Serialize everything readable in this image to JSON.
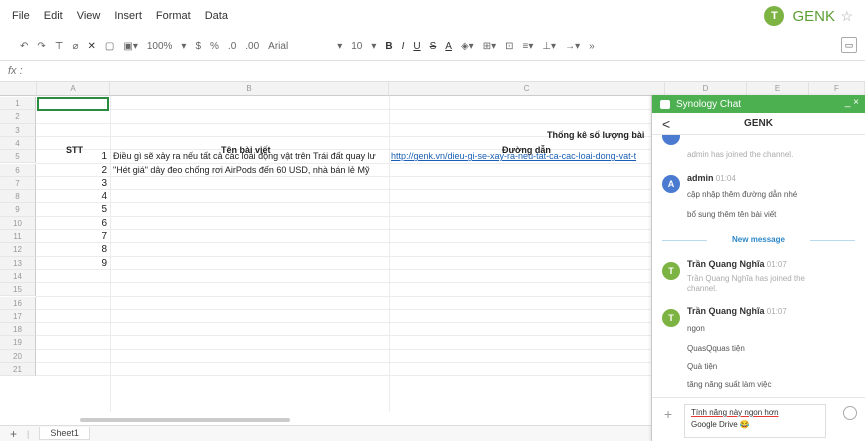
{
  "menu": [
    "File",
    "Edit",
    "View",
    "Insert",
    "Format",
    "Data"
  ],
  "brand": {
    "initial": "T",
    "name": "GENK",
    "star": "☆"
  },
  "toolbar": {
    "zoom": "100%",
    "currency": "$",
    "percent": "%",
    "font": "Arial",
    "font_size": "10",
    "bold": "B",
    "italic": "I",
    "underline": "U",
    "strike": "S",
    "textcolor": "A"
  },
  "formula": {
    "label": "fx :"
  },
  "columns": [
    "A",
    "B",
    "C",
    "D",
    "E",
    "F"
  ],
  "rows": [
    "1",
    "2",
    "3",
    "4",
    "5",
    "6",
    "7",
    "8",
    "9",
    "10",
    "11",
    "12",
    "13",
    "14",
    "15",
    "16",
    "17",
    "18",
    "19",
    "20",
    "21"
  ],
  "sheet": {
    "header_title": "Thống kê số lượng bài",
    "col_stt": "STT",
    "col_title": "Tên bài viết",
    "col_link": "Đường dẫn",
    "data": [
      {
        "stt": "1",
        "title": "Điều gì sẽ xảy ra nếu tất cả các loài động vật trên Trái đất quay lư",
        "link": "http://genk.vn/dieu-gi-se-xay-ra-neu-tat-ca-cac-loai-dong-vat-t"
      },
      {
        "stt": "2",
        "title": "\"Hét giá\" dây đeo chống rơi AirPods đến 60 USD, nhà bán lẻ Mỹ",
        "link": ""
      },
      {
        "stt": "3",
        "title": "",
        "link": ""
      },
      {
        "stt": "4",
        "title": "",
        "link": ""
      },
      {
        "stt": "5",
        "title": "",
        "link": ""
      },
      {
        "stt": "6",
        "title": "",
        "link": ""
      },
      {
        "stt": "7",
        "title": "",
        "link": ""
      },
      {
        "stt": "8",
        "title": "",
        "link": ""
      },
      {
        "stt": "9",
        "title": "",
        "link": ""
      }
    ]
  },
  "sheet_tab": {
    "add": "+",
    "name": "Sheet1"
  },
  "chat": {
    "app": "Synology Chat",
    "controls": "_ ×",
    "channel": "GENK",
    "back": "<",
    "messages": {
      "join_admin": "admin has joined the channel.",
      "admin_name": "admin",
      "admin_time": "01:04",
      "admin_line1": "cập nhập thêm đường dẫn nhé",
      "admin_line2": "bổ sung thêm tên bài viết",
      "new_message": "New message",
      "t1_name": "Trần Quang Nghĩa",
      "t1_time": "01:07",
      "t1_sys1": "Trần Quang Nghĩa has joined the",
      "t1_sys2": "channel.",
      "t2_name": "Trần Quang Nghĩa",
      "t2_time": "01:07",
      "t2_l1": "ngon",
      "t2_l2": "QuasQquas tiện",
      "t2_l3": "Quà tiện",
      "t2_l4": "tăng năng suất làm việc"
    },
    "compose": {
      "line1": "Tính năng này ngon hơn",
      "line2": "Google Drive 😂"
    },
    "avatar_admin": "A",
    "avatar_t": "T"
  }
}
